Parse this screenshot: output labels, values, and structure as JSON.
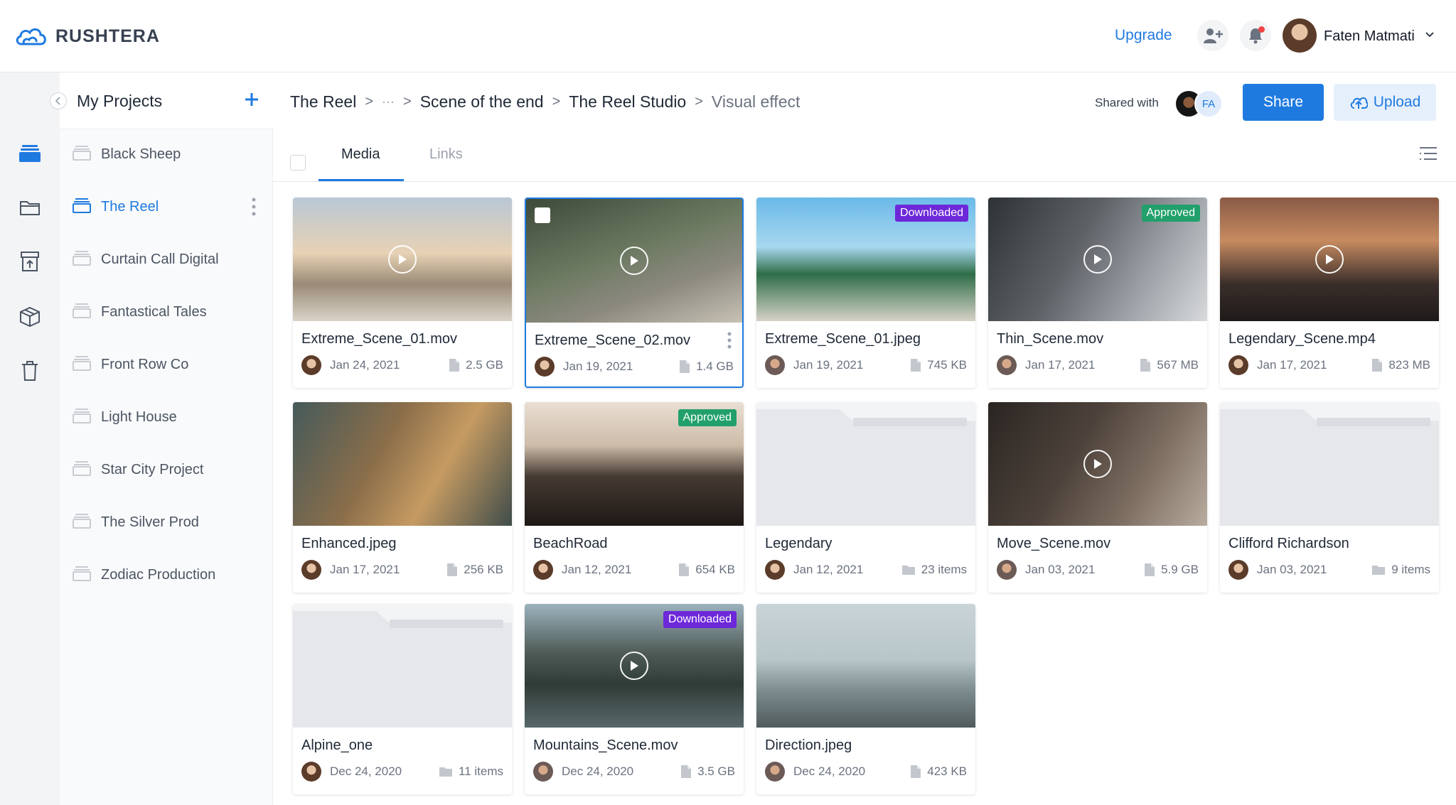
{
  "app": {
    "brand": "RUSHTERA",
    "upgrade_label": "Upgrade",
    "user_name": "Faten Matmati",
    "accent": "#1f7ae0"
  },
  "rail": {
    "items": [
      {
        "icon": "stack-icon",
        "active": true
      },
      {
        "icon": "folder-icon"
      },
      {
        "icon": "archive-upload-icon"
      },
      {
        "icon": "package-icon"
      },
      {
        "icon": "trash-icon"
      }
    ]
  },
  "projects": {
    "title": "My Projects",
    "items": [
      {
        "label": "Black Sheep"
      },
      {
        "label": "The Reel",
        "active": true
      },
      {
        "label": "Curtain Call Digital"
      },
      {
        "label": "Fantastical Tales"
      },
      {
        "label": "Front Row Co"
      },
      {
        "label": "Light House"
      },
      {
        "label": "Star City Project"
      },
      {
        "label": "The Silver Prod"
      },
      {
        "label": "Zodiac Production"
      }
    ]
  },
  "breadcrumb": {
    "items": [
      "The Reel",
      "···",
      "Scene of the end",
      "The Reel Studio",
      "Visual effect"
    ]
  },
  "toolbar": {
    "shared_label": "Shared with",
    "shared_initials": "FA",
    "share_label": "Share",
    "upload_label": "Upload"
  },
  "tabs": {
    "media": "Media",
    "links": "Links"
  },
  "cards": [
    {
      "name": "Extreme_Scene_01.mov",
      "date": "Jan 24, 2021",
      "size": "2.5 GB",
      "kind": "video",
      "badge": null
    },
    {
      "name": "Extreme_Scene_02.mov",
      "date": "Jan 19, 2021",
      "size": "1.4 GB",
      "kind": "video",
      "badge": null,
      "selected": true
    },
    {
      "name": "Extreme_Scene_01.jpeg",
      "date": "Jan 19, 2021",
      "size": "745 KB",
      "kind": "image",
      "badge": "Downloaded"
    },
    {
      "name": "Thin_Scene.mov",
      "date": "Jan 17, 2021",
      "size": "567 MB",
      "kind": "video",
      "badge": "Approved"
    },
    {
      "name": "Legendary_Scene.mp4",
      "date": "Jan 17, 2021",
      "size": "823 MB",
      "kind": "video",
      "badge": null
    },
    {
      "name": "Enhanced.jpeg",
      "date": "Jan 17, 2021",
      "size": "256 KB",
      "kind": "image",
      "badge": null
    },
    {
      "name": "BeachRoad",
      "date": "Jan 12, 2021",
      "size": "654 KB",
      "kind": "image",
      "badge": "Approved"
    },
    {
      "name": "Legendary",
      "date": "Jan 12, 2021",
      "size": "23 items",
      "kind": "folder",
      "badge": null
    },
    {
      "name": "Move_Scene.mov",
      "date": "Jan 03, 2021",
      "size": "5.9 GB",
      "kind": "video",
      "badge": null
    },
    {
      "name": "Clifford Richardson",
      "date": "Jan 03, 2021",
      "size": "9 items",
      "kind": "folder",
      "badge": null
    },
    {
      "name": "Alpine_one",
      "date": "Dec 24, 2020",
      "size": "11 items",
      "kind": "folder",
      "badge": null
    },
    {
      "name": "Mountains_Scene.mov",
      "date": "Dec 24, 2020",
      "size": "3.5 GB",
      "kind": "video",
      "badge": "Downloaded"
    },
    {
      "name": "Direction.jpeg",
      "date": "Dec 24, 2020",
      "size": "423 KB",
      "kind": "image",
      "badge": null
    }
  ],
  "colors": {
    "downloaded_badge": "#6d28d9",
    "approved_badge": "#22a06b",
    "notification_dot": "#ef4444"
  }
}
